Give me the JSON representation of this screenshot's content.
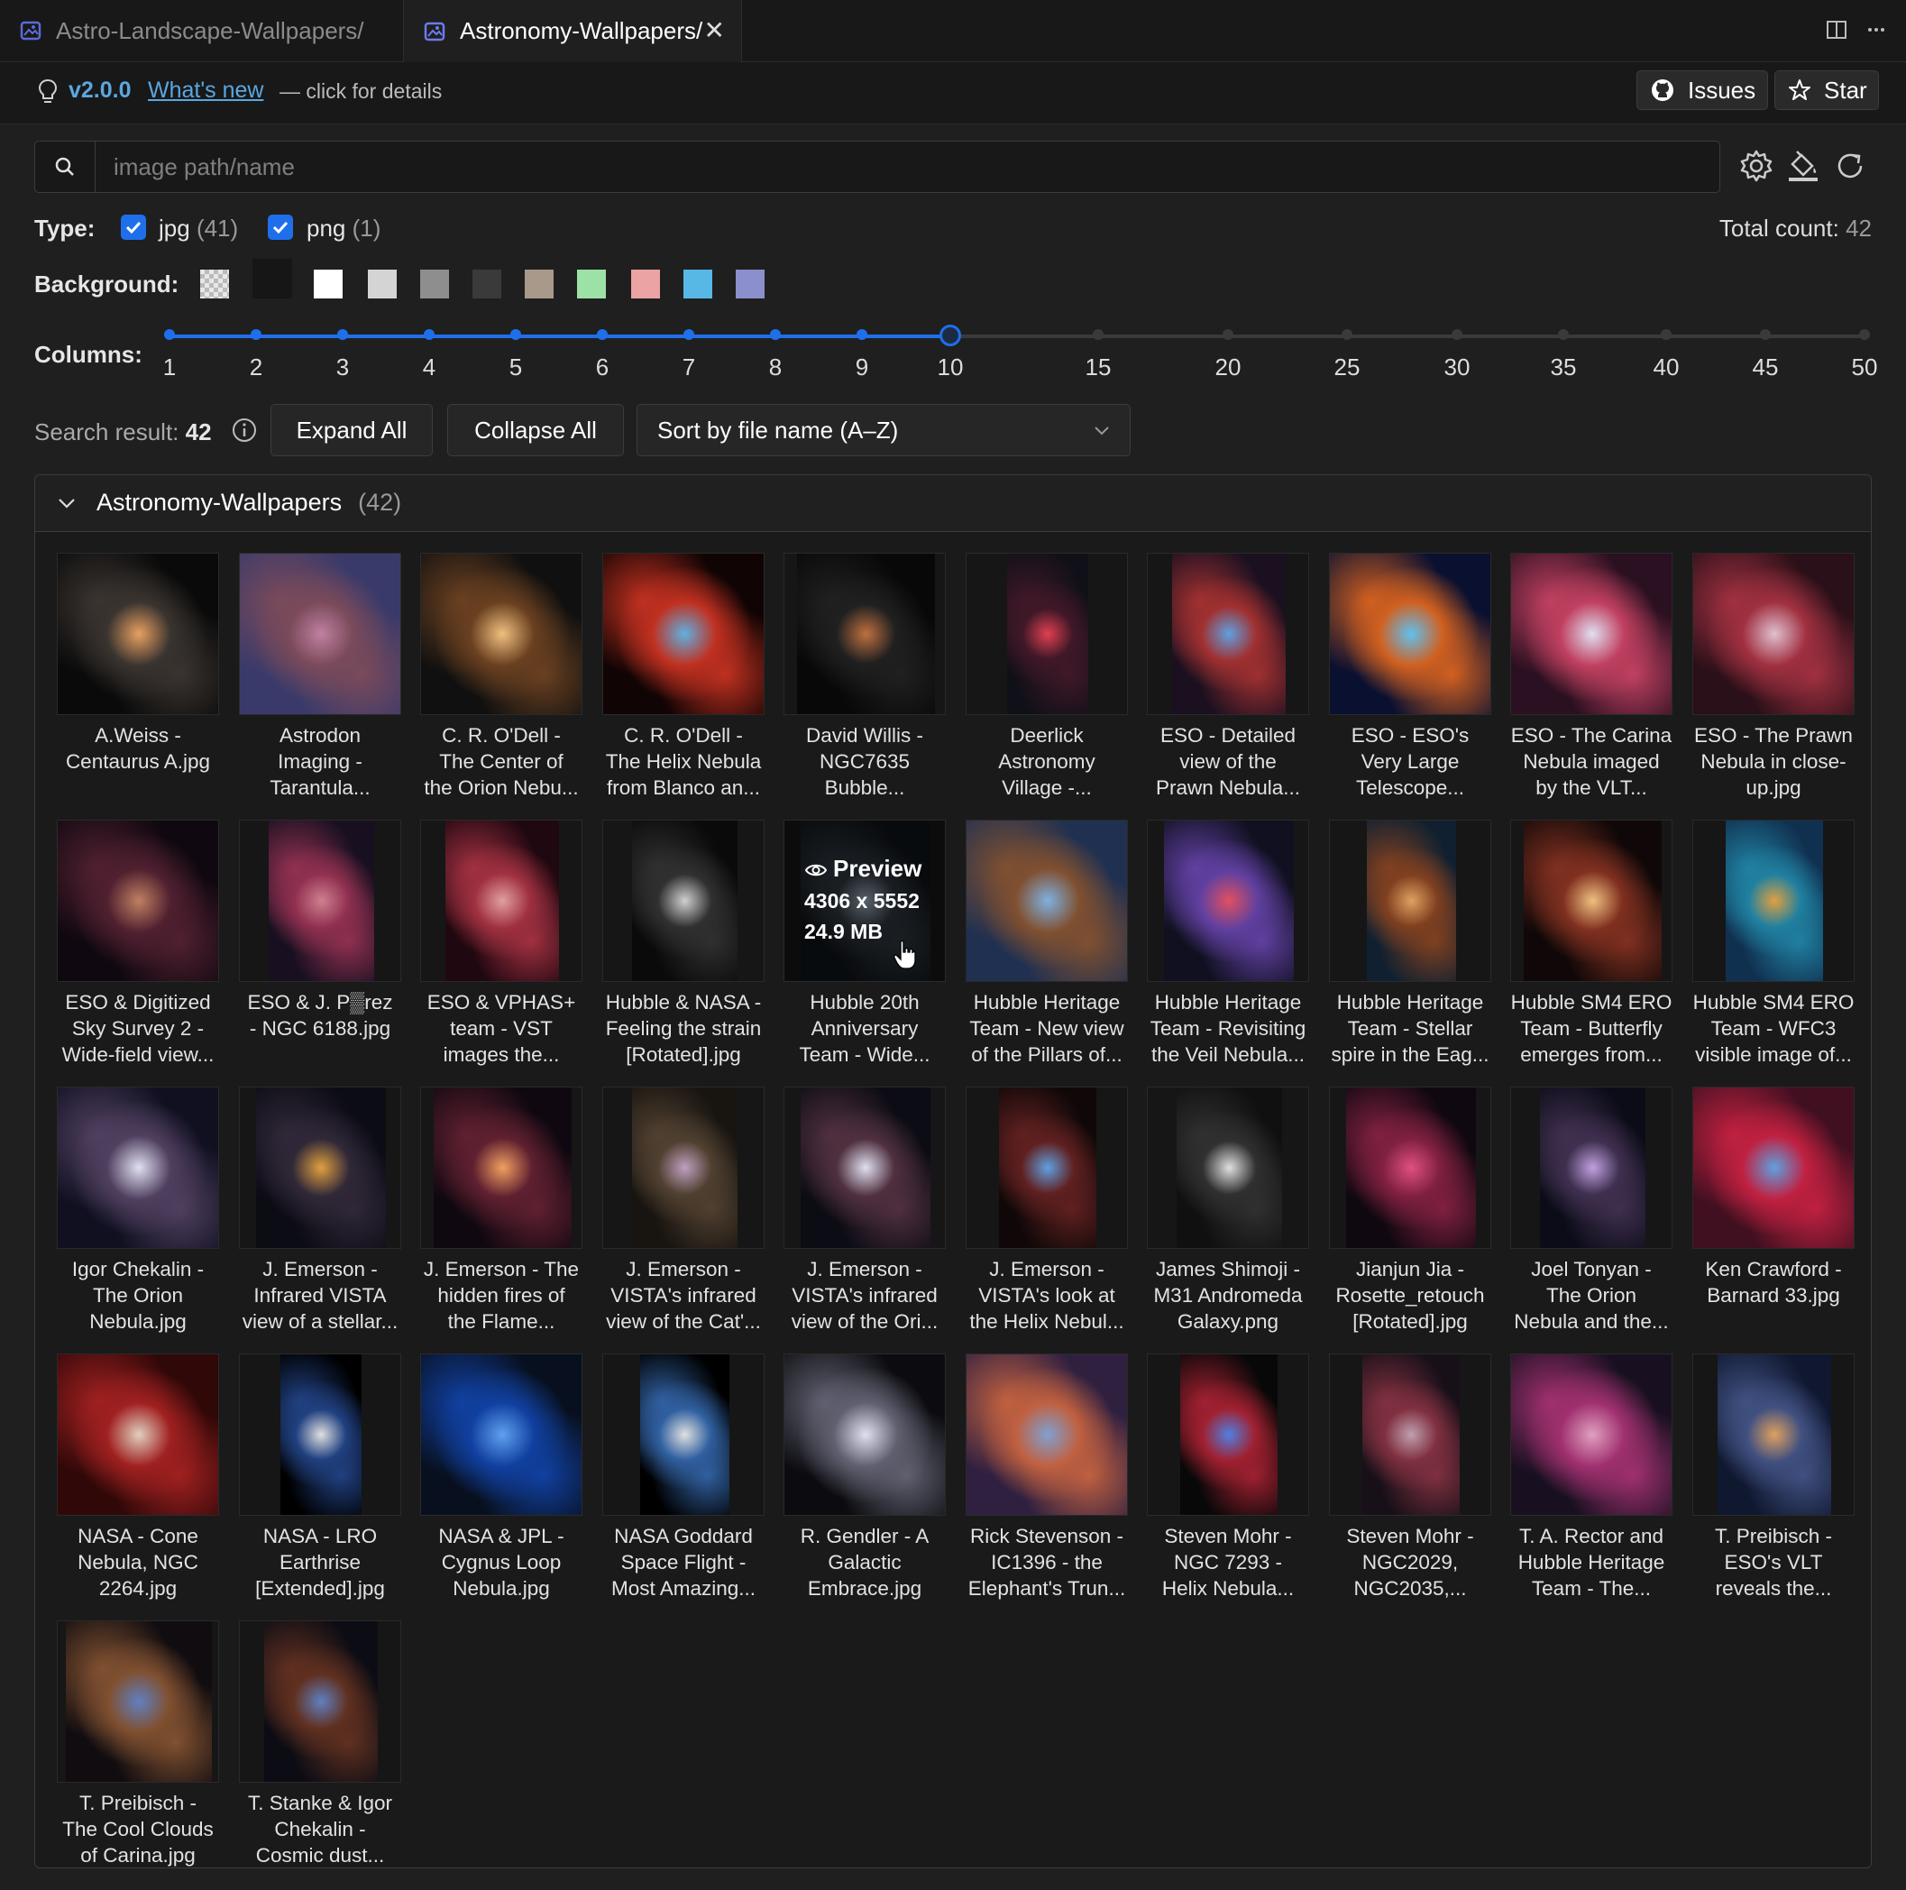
{
  "tabs": [
    {
      "label": "Astro-Landscape-Wallpapers/",
      "active": false
    },
    {
      "label": "Astronomy-Wallpapers/",
      "active": true
    }
  ],
  "infobar": {
    "version": "v2.0.0",
    "whats_new": "What's new",
    "details": "— click for details",
    "issues_label": "Issues",
    "star_label": "Star"
  },
  "search": {
    "placeholder": "image path/name",
    "value": ""
  },
  "type_filter": {
    "label": "Type:",
    "options": [
      {
        "name": "jpg",
        "count": "(41)",
        "checked": true
      },
      {
        "name": "png",
        "count": "(1)",
        "checked": true
      }
    ],
    "total_label": "Total count:",
    "total_value": "42"
  },
  "background": {
    "label": "Background:",
    "swatches": [
      "checker",
      "#161616",
      "#ffffff",
      "#d4d4d4",
      "#8e8e8e",
      "#3a3a3a",
      "#a8998a",
      "#9ce2a6",
      "#eba3a3",
      "#57b8e6",
      "#8b8fcb"
    ],
    "selected": 1
  },
  "columns": {
    "label": "Columns:",
    "ticks": [
      "1",
      "2",
      "3",
      "4",
      "5",
      "6",
      "7",
      "8",
      "9",
      "10",
      "15",
      "20",
      "25",
      "30",
      "35",
      "40",
      "45",
      "50"
    ],
    "value": "10"
  },
  "results": {
    "label": "Search result:",
    "count": "42",
    "expand_all": "Expand All",
    "collapse_all": "Collapse All",
    "sort": "Sort by file name (A–Z)"
  },
  "folder": {
    "name": "Astronomy-Wallpapers",
    "count": "(42)"
  },
  "hover": {
    "preview": "Preview",
    "dims": "4306 x 5552",
    "size": "24.9 MB"
  },
  "images": [
    {
      "caption": "A.Weiss -\nCentaurus A.jpg",
      "colors": [
        "#0a0a0a",
        "#3a3430",
        "#e8a060"
      ],
      "aspect": 1
    },
    {
      "caption": "Astrodon\nImaging -\nTarantula...",
      "colors": [
        "#3a3a6a",
        "#7a4a5a",
        "#c080a0"
      ],
      "aspect": 1
    },
    {
      "caption": "C. R. O'Dell -\nThe Center of\nthe Orion Nebu...",
      "colors": [
        "#101010",
        "#6a4020",
        "#f0c080"
      ],
      "aspect": 1
    },
    {
      "caption": "C. R. O'Dell -\nThe Helix Nebula\nfrom Blanco an...",
      "colors": [
        "#100404",
        "#c03020",
        "#60b0e0"
      ],
      "aspect": 1
    },
    {
      "caption": "David Willis -\nNGC7635\nBubble...",
      "colors": [
        "#080808",
        "#202020",
        "#c07040"
      ],
      "aspect": 0.85
    },
    {
      "caption": "Deerlick\nAstronomy\nVillage -...",
      "colors": [
        "#101018",
        "#401828",
        "#e04050"
      ],
      "aspect": 0.5
    },
    {
      "caption": "ESO - Detailed\nview of the\nPrawn Nebula...",
      "colors": [
        "#1a1020",
        "#a03030",
        "#60a0e0"
      ],
      "aspect": 0.7
    },
    {
      "caption": "ESO - ESO's\nVery Large\nTelescope...",
      "colors": [
        "#0a1030",
        "#d06020",
        "#60c0f0"
      ],
      "aspect": 1
    },
    {
      "caption": "ESO - The Carina\nNebula imaged\nby the VLT...",
      "colors": [
        "#2a1020",
        "#c04060",
        "#e0e0f0"
      ],
      "aspect": 1
    },
    {
      "caption": "ESO - The Prawn\nNebula in close-\nup.jpg",
      "colors": [
        "#2a1018",
        "#a03040",
        "#e0c0d0"
      ],
      "aspect": 1
    },
    {
      "caption": "ESO & Digitized\nSky Survey 2 -\nWide-field view...",
      "colors": [
        "#100810",
        "#502030",
        "#c08060"
      ],
      "aspect": 1
    },
    {
      "caption": "ESO & J. P▒rez\n- NGC 6188.jpg",
      "colors": [
        "#181020",
        "#903050",
        "#d08090"
      ],
      "aspect": 0.65
    },
    {
      "caption": "ESO & VPHAS+\nteam - VST\nimages the...",
      "colors": [
        "#200810",
        "#a03040",
        "#e0a0a0"
      ],
      "aspect": 0.7
    },
    {
      "caption": "Hubble & NASA -\nFeeling the strain\n[Rotated].jpg",
      "colors": [
        "#0a0a0a",
        "#303030",
        "#d0d0d0"
      ],
      "aspect": 0.65
    },
    {
      "caption": "Hubble 20th\nAnniversary\nTeam - Wide...",
      "colors": [
        "#101418",
        "#303840",
        "#a0b0c0"
      ],
      "aspect": 0.8
    },
    {
      "caption": "Hubble Heritage\nTeam - New view\nof the Pillars of...",
      "colors": [
        "#203050",
        "#805030",
        "#80b0e0"
      ],
      "aspect": 1
    },
    {
      "caption": "Hubble Heritage\nTeam - Revisiting\nthe Veil Nebula...",
      "colors": [
        "#101020",
        "#6040a0",
        "#e05060"
      ],
      "aspect": 0.8
    },
    {
      "caption": "Hubble Heritage\nTeam - Stellar\nspire in the Eag...",
      "colors": [
        "#102030",
        "#804020",
        "#e0a060"
      ],
      "aspect": 0.55
    },
    {
      "caption": "Hubble SM4 ERO\nTeam - Butterfly\nemerges from...",
      "colors": [
        "#100808",
        "#803020",
        "#f0c080"
      ],
      "aspect": 0.85
    },
    {
      "caption": "Hubble SM4 ERO\nTeam - WFC3\nvisible image of...",
      "colors": [
        "#103050",
        "#2080a0",
        "#e0a040"
      ],
      "aspect": 0.6
    },
    {
      "caption": "Igor Chekalin -\nThe Orion\nNebula.jpg",
      "colors": [
        "#101020",
        "#504060",
        "#e0e0f0"
      ],
      "aspect": 1
    },
    {
      "caption": "J. Emerson -\nInfrared VISTA\nview of a stellar...",
      "colors": [
        "#0c0c14",
        "#302838",
        "#e0a040"
      ],
      "aspect": 0.8
    },
    {
      "caption": "J. Emerson - The\nhidden fires of\nthe Flame...",
      "colors": [
        "#100810",
        "#602030",
        "#f0a060"
      ],
      "aspect": 0.85
    },
    {
      "caption": "J. Emerson -\nVISTA's infrared\nview of the Cat'...",
      "colors": [
        "#181410",
        "#504030",
        "#c0a0c0"
      ],
      "aspect": 0.65
    },
    {
      "caption": "J. Emerson -\nVISTA's infrared\nview of the Ori...",
      "colors": [
        "#0c0c14",
        "#503040",
        "#e0e0f0"
      ],
      "aspect": 0.8
    },
    {
      "caption": "J. Emerson -\nVISTA's look at\nthe Helix Nebul...",
      "colors": [
        "#100808",
        "#602020",
        "#60a0e0"
      ],
      "aspect": 0.6
    },
    {
      "caption": "James Shimoji -\nM31 Andromeda\nGalaxy.png",
      "colors": [
        "#101010",
        "#303030",
        "#e0e0e0"
      ],
      "aspect": 0.65
    },
    {
      "caption": "Jianjun Jia -\nRosette_retouch\n[Rotated].jpg",
      "colors": [
        "#100810",
        "#802040",
        "#e05080"
      ],
      "aspect": 0.8
    },
    {
      "caption": "Joel Tonyan -\nThe Orion\nNebula and the...",
      "colors": [
        "#0c0c18",
        "#403050",
        "#c0a0e0"
      ],
      "aspect": 0.65
    },
    {
      "caption": "Ken Crawford -\nBarnard 33.jpg",
      "colors": [
        "#401020",
        "#c02040",
        "#60a0e0"
      ],
      "aspect": 1
    },
    {
      "caption": "NASA - Cone\nNebula, NGC\n2264.jpg",
      "colors": [
        "#300808",
        "#a02020",
        "#e0d0c0"
      ],
      "aspect": 1
    },
    {
      "caption": "NASA - LRO\nEarthrise\n[Extended].jpg",
      "colors": [
        "#000000",
        "#204080",
        "#e0e0e0"
      ],
      "aspect": 0.5
    },
    {
      "caption": "NASA & JPL -\nCygnus Loop\nNebula.jpg",
      "colors": [
        "#081020",
        "#1040a0",
        "#60a0f0"
      ],
      "aspect": 1
    },
    {
      "caption": "NASA Goddard\nSpace Flight -\nMost Amazing...",
      "colors": [
        "#000000",
        "#3060a0",
        "#e0e0e0"
      ],
      "aspect": 0.55
    },
    {
      "caption": "R. Gendler - A\nGalactic\nEmbrace.jpg",
      "colors": [
        "#0c0c10",
        "#606070",
        "#e0e0f0"
      ],
      "aspect": 1
    },
    {
      "caption": "Rick Stevenson -\nIC1396 - the\nElephant's Trun...",
      "colors": [
        "#302040",
        "#c06040",
        "#80a0d0"
      ],
      "aspect": 1
    },
    {
      "caption": "Steven Mohr -\nNGC 7293 -\nHelix Nebula...",
      "colors": [
        "#080808",
        "#a02030",
        "#5080e0"
      ],
      "aspect": 0.6
    },
    {
      "caption": "Steven Mohr -\nNGC2029,\nNGC2035,...",
      "colors": [
        "#181018",
        "#803040",
        "#c0a0b0"
      ],
      "aspect": 0.6
    },
    {
      "caption": "T. A. Rector and\nHubble Heritage\nTeam - The...",
      "colors": [
        "#181020",
        "#a03070",
        "#e0a0c0"
      ],
      "aspect": 1
    },
    {
      "caption": "T. Preibisch -\nESO's VLT\nreveals the...",
      "colors": [
        "#101830",
        "#405080",
        "#e0a060"
      ],
      "aspect": 0.7
    },
    {
      "caption": "T. Preibisch -\nThe Cool Clouds\nof Carina.jpg",
      "colors": [
        "#100c10",
        "#805030",
        "#6080c0"
      ],
      "aspect": 0.9
    },
    {
      "caption": "T. Stanke & Igor\nChekalin -\nCosmic dust...",
      "colors": [
        "#0c0c14",
        "#603020",
        "#6080c0"
      ],
      "aspect": 0.7
    }
  ]
}
